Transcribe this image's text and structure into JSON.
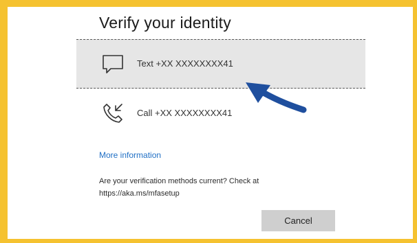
{
  "dialog": {
    "title": "Verify your identity",
    "options": [
      {
        "label": "Text +XX XXXXXXXX41",
        "icon": "message-icon",
        "selected": true
      },
      {
        "label": "Call +XX XXXXXXXX41",
        "icon": "phone-call-icon",
        "selected": false
      }
    ],
    "more_info_link": "More information",
    "note_line1": "Are your verification methods current? Check at",
    "note_line2": "https://aka.ms/mfasetup",
    "cancel_label": "Cancel"
  },
  "colors": {
    "frame": "#f5c230",
    "selected_bg": "#e6e6e6",
    "link": "#1f6fc5",
    "arrow": "#1f4f9e",
    "button_bg": "#cfcfcf"
  }
}
